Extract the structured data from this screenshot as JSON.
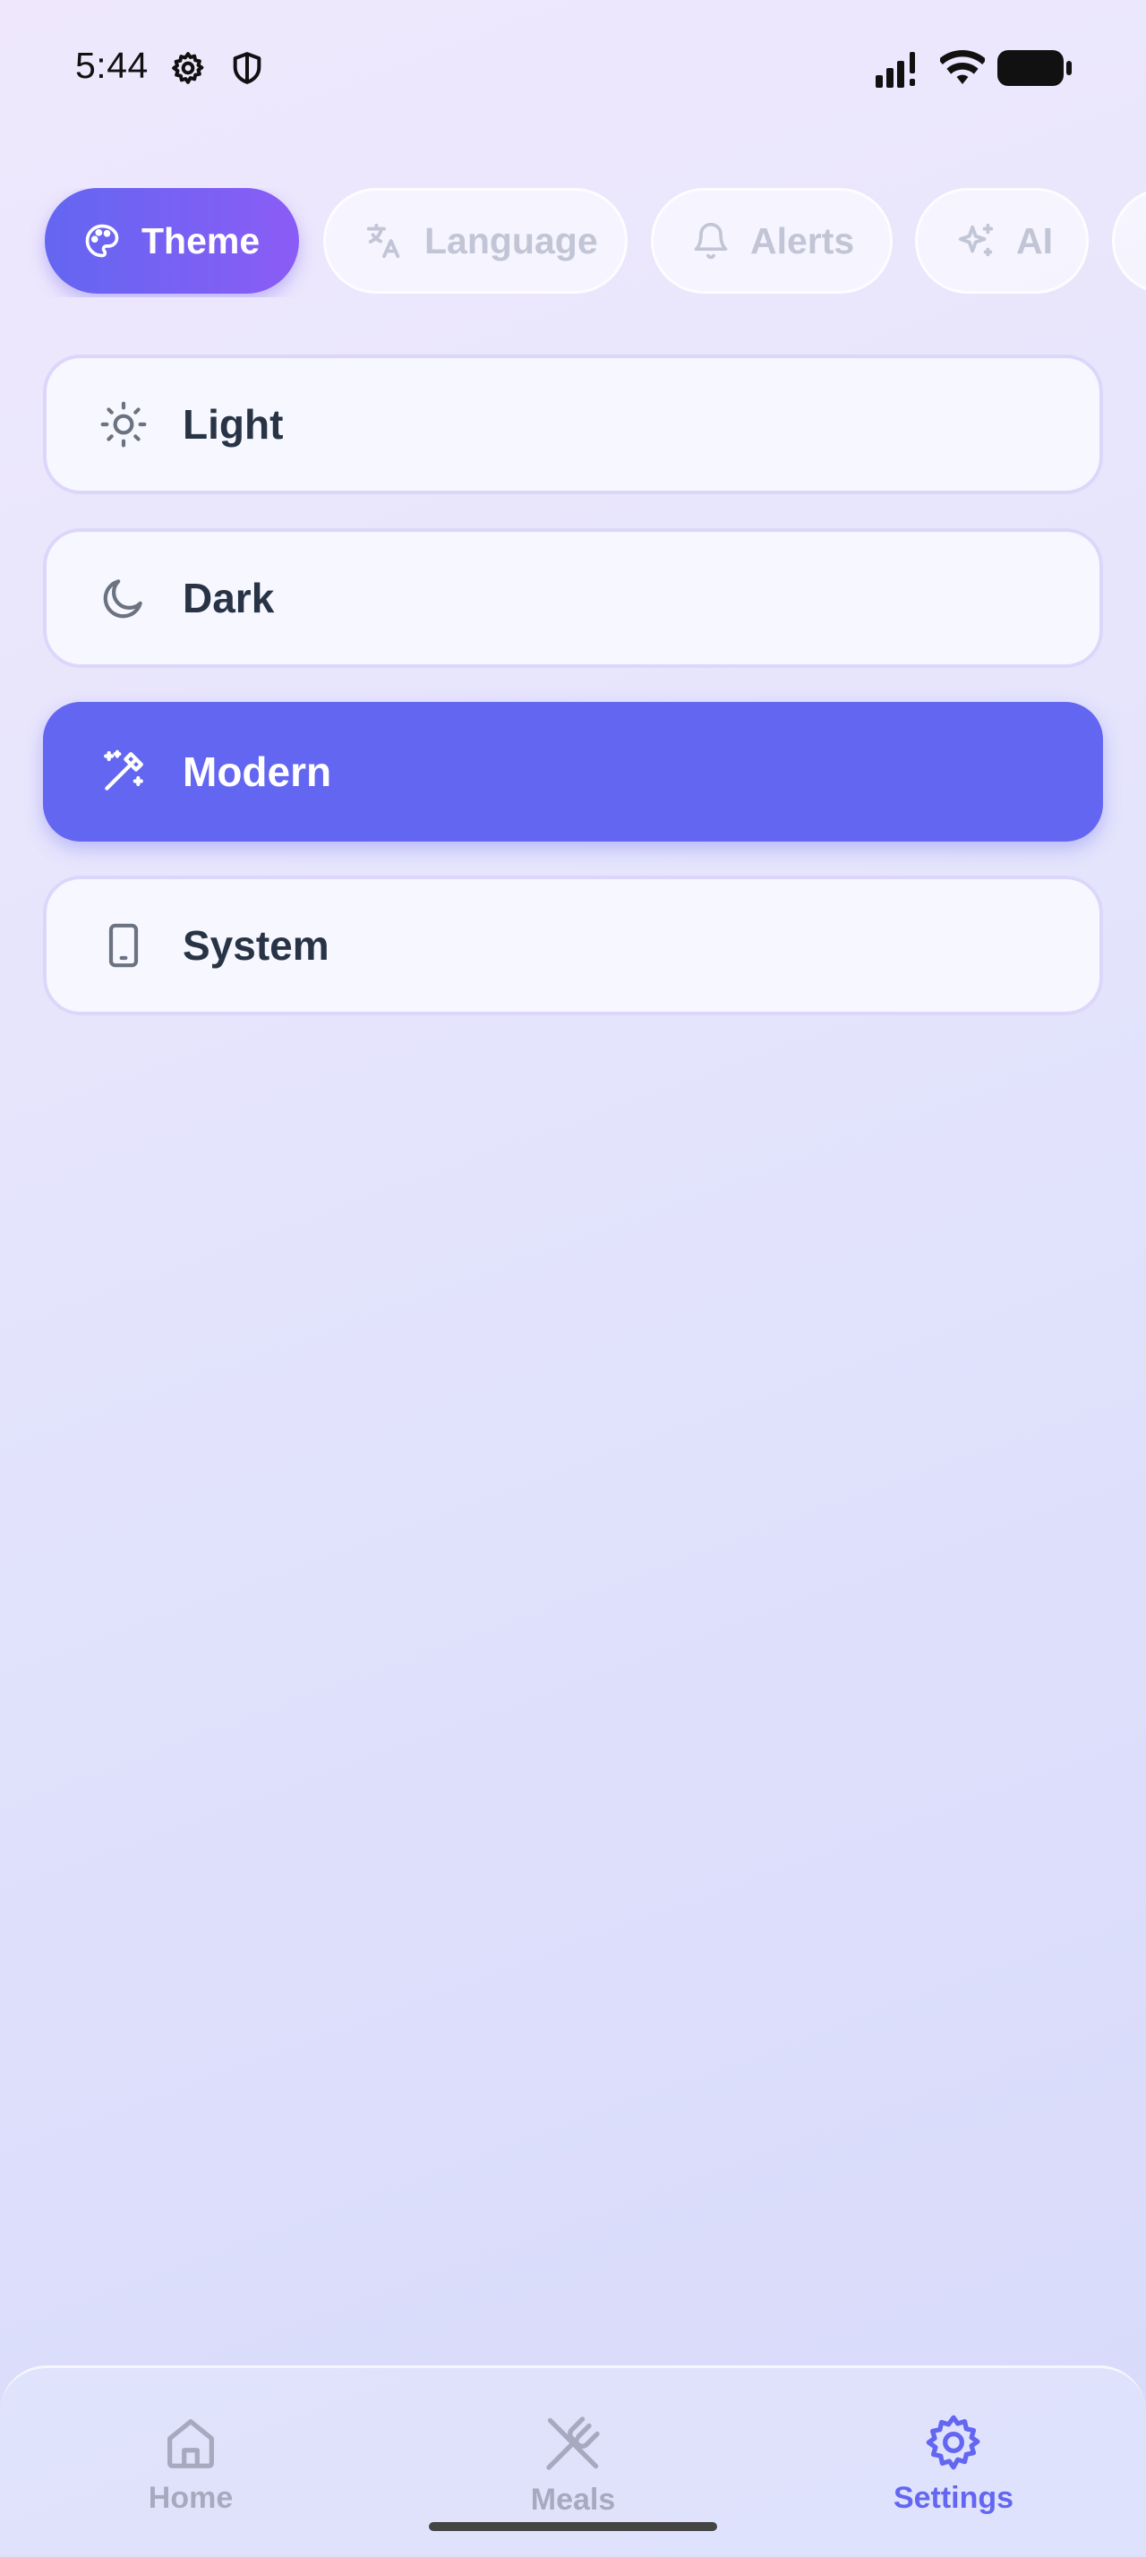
{
  "status_bar": {
    "time": "5:44",
    "icons": [
      "gear-icon",
      "shield-icon",
      "signal-icon",
      "wifi-icon",
      "battery-icon"
    ]
  },
  "tabs": [
    {
      "label": "Theme",
      "icon": "palette-icon",
      "active": true
    },
    {
      "label": "Language",
      "icon": "translate-icon",
      "active": false
    },
    {
      "label": "Alerts",
      "icon": "bell-icon",
      "active": false
    },
    {
      "label": "AI",
      "icon": "sparkles-icon",
      "active": false
    }
  ],
  "theme_options": [
    {
      "label": "Light",
      "icon": "sun-icon",
      "selected": false
    },
    {
      "label": "Dark",
      "icon": "moon-icon",
      "selected": false
    },
    {
      "label": "Modern",
      "icon": "magic-wand-icon",
      "selected": true
    },
    {
      "label": "System",
      "icon": "phone-icon",
      "selected": false
    }
  ],
  "bottom_nav": [
    {
      "label": "Home",
      "icon": "home-icon",
      "active": false
    },
    {
      "label": "Meals",
      "icon": "utensils-icon",
      "active": false
    },
    {
      "label": "Settings",
      "icon": "gear-icon",
      "active": true
    }
  ],
  "colors": {
    "accent": "#6366f1",
    "accent_gradient_end": "#8b5cf6",
    "text_dark": "#283445",
    "tab_inactive_text": "#c2c5d6",
    "nav_inactive": "#a7aabf"
  }
}
